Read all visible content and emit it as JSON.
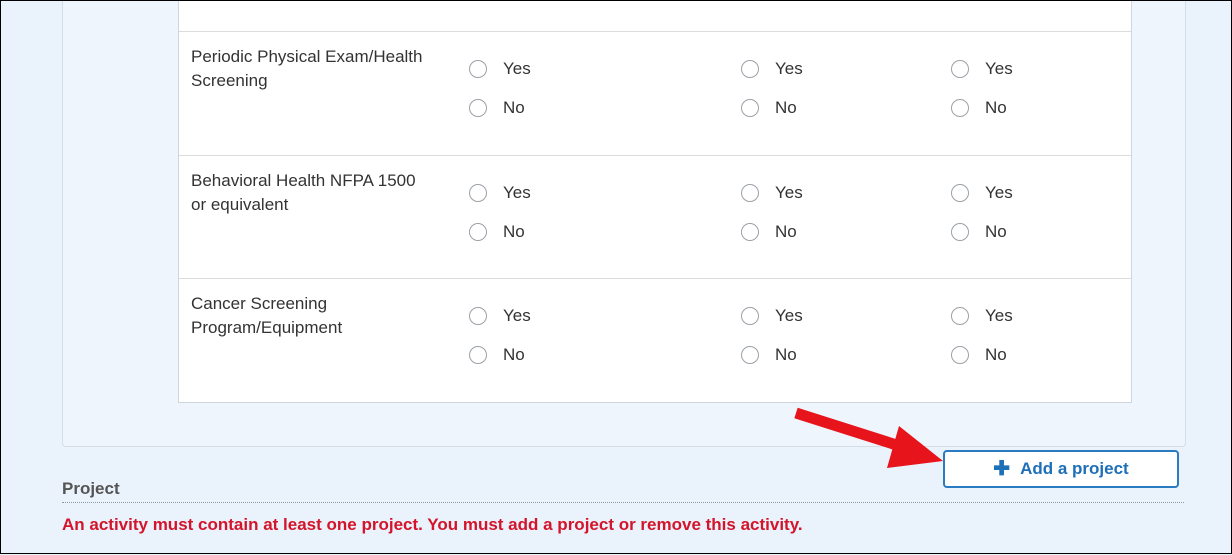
{
  "form": {
    "rows": [
      {
        "label": "Periodic Physical Exam/Health Screening"
      },
      {
        "label": "Behavioral Health NFPA 1500 or equivalent"
      },
      {
        "label": "Cancer Screening Program/Equipment"
      }
    ],
    "option_yes": "Yes",
    "option_no": "No"
  },
  "actions": {
    "add_project_label": "Add a project",
    "add_project_icon": "plus-icon"
  },
  "project": {
    "section_label": "Project",
    "error_message": "An activity must contain at least one project. You must add a project or remove this activity."
  },
  "annotation": {
    "arrow_color": "#e8141c"
  }
}
